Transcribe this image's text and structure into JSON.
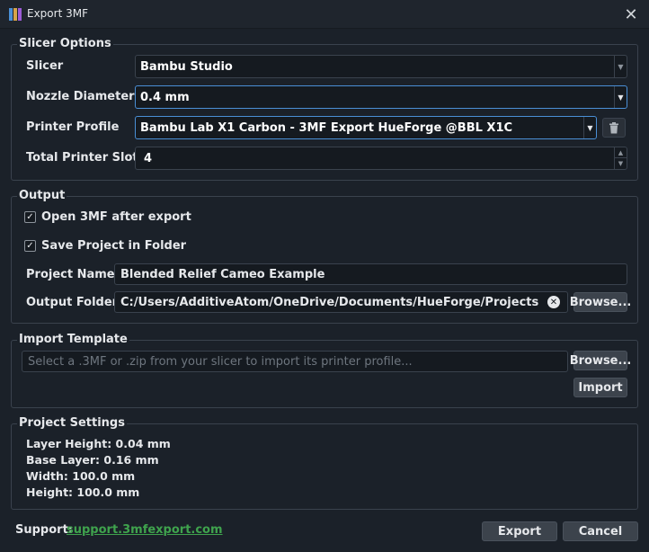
{
  "window": {
    "title": "Export 3MF",
    "close_glyph": "✕"
  },
  "slicer_options": {
    "title": "Slicer Options",
    "slicer": {
      "label": "Slicer",
      "value": "Bambu Studio"
    },
    "nozzle": {
      "label": "Nozzle Diameter",
      "value": "0.4 mm"
    },
    "printer_profile": {
      "label": "Printer Profile",
      "value": "Bambu Lab X1 Carbon - 3MF Export HueForge @BBL X1C"
    },
    "total_slots": {
      "label": "Total Printer Slots",
      "value": "4"
    }
  },
  "output": {
    "title": "Output",
    "open_after_export": {
      "label": "Open 3MF after export",
      "checked": true
    },
    "save_in_folder": {
      "label": "Save Project in Folder",
      "checked": true
    },
    "project_name": {
      "label": "Project Name",
      "value": "Blended Relief Cameo Example"
    },
    "output_folder": {
      "label": "Output Folder",
      "value": "C:/Users/AdditiveAtom/OneDrive/Documents/HueForge/Projects"
    },
    "browse_label": "Browse..."
  },
  "import_template": {
    "title": "Import Template",
    "placeholder": "Select a .3MF or .zip from your slicer to import its printer profile...",
    "browse_label": "Browse...",
    "import_label": "Import"
  },
  "project_settings": {
    "title": "Project Settings",
    "lines": [
      "Layer Height: 0.04 mm",
      "Base Layer: 0.16 mm",
      "Width: 100.0 mm",
      "Height: 100.0 mm"
    ]
  },
  "footer": {
    "support_label": "Support:",
    "support_link": "support.3mfexport.com",
    "export_label": "Export",
    "cancel_label": "Cancel"
  },
  "colors": {
    "background": "#1b2129",
    "accent": "#4a8fd6",
    "link": "#3fa34d"
  },
  "icons": {
    "app": "app-icon",
    "close": "close-icon",
    "dropdown": "chevron-down-icon",
    "trash": "trash-icon",
    "clear": "clear-icon",
    "check": "check-icon"
  }
}
